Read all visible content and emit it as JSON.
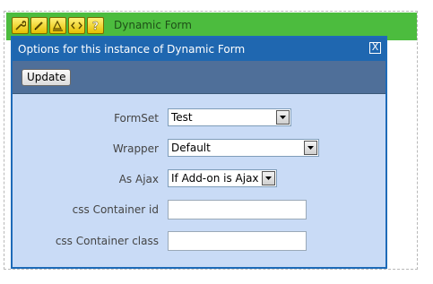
{
  "module": {
    "title": "Dynamic Form",
    "toolbar_icons": [
      "wrench-icon",
      "pencil-icon",
      "edit-template-icon",
      "code-icon",
      "help-icon"
    ]
  },
  "dialog": {
    "title": "Options for this instance of Dynamic Form",
    "close_label": "X",
    "update_label": "Update"
  },
  "form": {
    "formset": {
      "label": "FormSet",
      "value": "Test"
    },
    "wrapper": {
      "label": "Wrapper",
      "value": "Default"
    },
    "as_ajax": {
      "label": "As Ajax",
      "value": "If Add-on is Ajax"
    },
    "css_container_id": {
      "label": "css Container id",
      "value": ""
    },
    "css_container_class": {
      "label": "css Container class",
      "value": ""
    }
  },
  "colors": {
    "module_bar": "#4cbc3e",
    "dialog_title": "#1f67b0",
    "dialog_toolbar": "#4f6f99",
    "dialog_body": "#c9dbf6"
  }
}
